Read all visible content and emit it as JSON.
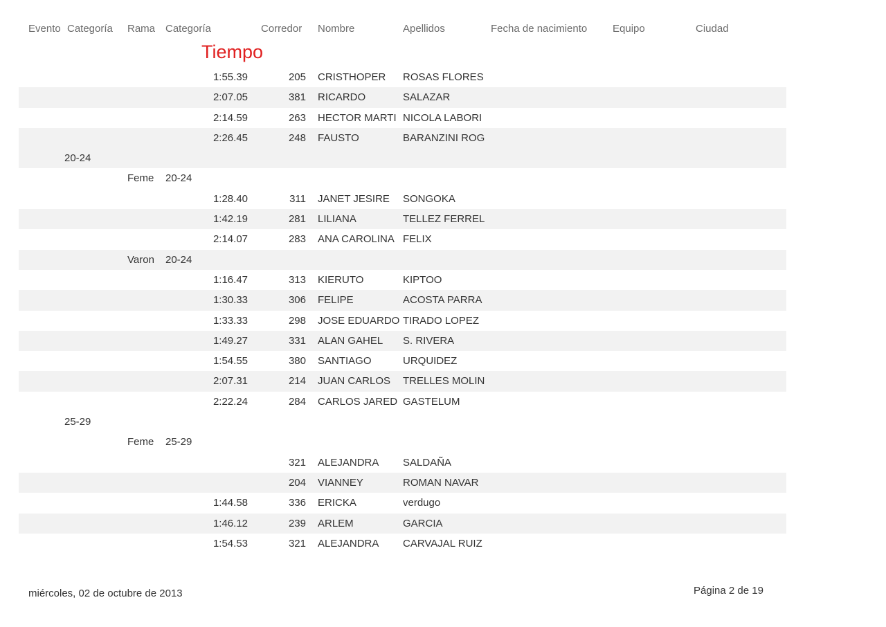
{
  "header": {
    "evento": "Evento",
    "categoria1": "Categoría",
    "rama": "Rama",
    "categoria2": "Categoría",
    "corredor": "Corredor",
    "nombre": "Nombre",
    "apellidos": "Apellidos",
    "fecha": "Fecha de nacimiento",
    "equipo": "Equipo",
    "ciudad": "Ciudad",
    "tiempo": "Tiempo"
  },
  "rows": [
    {
      "grupo": "",
      "rama": "",
      "cat": "",
      "tiempo": "1:55.39",
      "corredor": "205",
      "nombre": "CRISTHOPER",
      "apellidos": "ROSAS FLORES",
      "shade": false
    },
    {
      "grupo": "",
      "rama": "",
      "cat": "",
      "tiempo": "2:07.05",
      "corredor": "381",
      "nombre": "RICARDO",
      "apellidos": "SALAZAR",
      "shade": true
    },
    {
      "grupo": "",
      "rama": "",
      "cat": "",
      "tiempo": "2:14.59",
      "corredor": "263",
      "nombre": "HECTOR MARTI",
      "apellidos": "NICOLA LABORI",
      "shade": false
    },
    {
      "grupo": "",
      "rama": "",
      "cat": "",
      "tiempo": "2:26.45",
      "corredor": "248",
      "nombre": "FAUSTO",
      "apellidos": "BARANZINI ROG",
      "shade": true
    },
    {
      "grupo": "20-24",
      "rama": "",
      "cat": "",
      "tiempo": "",
      "corredor": "",
      "nombre": "",
      "apellidos": "",
      "shade": true
    },
    {
      "grupo": "",
      "rama": "Feme",
      "cat": "20-24",
      "tiempo": "",
      "corredor": "",
      "nombre": "",
      "apellidos": "",
      "shade": false
    },
    {
      "grupo": "",
      "rama": "",
      "cat": "",
      "tiempo": "1:28.40",
      "corredor": "311",
      "nombre": "JANET JESIRE",
      "apellidos": "SONGOKA",
      "shade": false
    },
    {
      "grupo": "",
      "rama": "",
      "cat": "",
      "tiempo": "1:42.19",
      "corredor": "281",
      "nombre": "LILIANA",
      "apellidos": "TELLEZ FERREL",
      "shade": true
    },
    {
      "grupo": "",
      "rama": "",
      "cat": "",
      "tiempo": "2:14.07",
      "corredor": "283",
      "nombre": "ANA CAROLINA",
      "apellidos": "FELIX",
      "shade": false
    },
    {
      "grupo": "",
      "rama": "Varon",
      "cat": "20-24",
      "tiempo": "",
      "corredor": "",
      "nombre": "",
      "apellidos": "",
      "shade": true
    },
    {
      "grupo": "",
      "rama": "",
      "cat": "",
      "tiempo": "1:16.47",
      "corredor": "313",
      "nombre": "KIERUTO",
      "apellidos": "KIPTOO",
      "shade": false
    },
    {
      "grupo": "",
      "rama": "",
      "cat": "",
      "tiempo": "1:30.33",
      "corredor": "306",
      "nombre": "FELIPE",
      "apellidos": "ACOSTA PARRA",
      "shade": true
    },
    {
      "grupo": "",
      "rama": "",
      "cat": "",
      "tiempo": "1:33.33",
      "corredor": "298",
      "nombre": "JOSE EDUARDO",
      "apellidos": "TIRADO LOPEZ",
      "shade": false
    },
    {
      "grupo": "",
      "rama": "",
      "cat": "",
      "tiempo": "1:49.27",
      "corredor": "331",
      "nombre": "ALAN GAHEL",
      "apellidos": "S. RIVERA",
      "shade": true
    },
    {
      "grupo": "",
      "rama": "",
      "cat": "",
      "tiempo": "1:54.55",
      "corredor": "380",
      "nombre": "SANTIAGO",
      "apellidos": "URQUIDEZ",
      "shade": false
    },
    {
      "grupo": "",
      "rama": "",
      "cat": "",
      "tiempo": "2:07.31",
      "corredor": "214",
      "nombre": "JUAN CARLOS",
      "apellidos": "TRELLES MOLIN",
      "shade": true
    },
    {
      "grupo": "",
      "rama": "",
      "cat": "",
      "tiempo": "2:22.24",
      "corredor": "284",
      "nombre": "CARLOS JARED",
      "apellidos": "GASTELUM",
      "shade": false
    },
    {
      "grupo": "25-29",
      "rama": "",
      "cat": "",
      "tiempo": "",
      "corredor": "",
      "nombre": "",
      "apellidos": "",
      "shade": false
    },
    {
      "grupo": "",
      "rama": "Feme",
      "cat": "25-29",
      "tiempo": "",
      "corredor": "",
      "nombre": "",
      "apellidos": "",
      "shade": false
    },
    {
      "grupo": "",
      "rama": "",
      "cat": "",
      "tiempo": "",
      "corredor": "321",
      "nombre": "ALEJANDRA",
      "apellidos": "SALDAÑA",
      "shade": false
    },
    {
      "grupo": "",
      "rama": "",
      "cat": "",
      "tiempo": "",
      "corredor": "204",
      "nombre": "VIANNEY",
      "apellidos": "ROMAN NAVAR",
      "shade": true
    },
    {
      "grupo": "",
      "rama": "",
      "cat": "",
      "tiempo": "1:44.58",
      "corredor": "336",
      "nombre": "ERICKA",
      "apellidos": "verdugo",
      "shade": false
    },
    {
      "grupo": "",
      "rama": "",
      "cat": "",
      "tiempo": "1:46.12",
      "corredor": "239",
      "nombre": "ARLEM",
      "apellidos": "GARCIA",
      "shade": true
    },
    {
      "grupo": "",
      "rama": "",
      "cat": "",
      "tiempo": "1:54.53",
      "corredor": "321",
      "nombre": "ALEJANDRA",
      "apellidos": "CARVAJAL RUIZ",
      "shade": false
    }
  ],
  "footer": {
    "date": "miércoles, 02 de octubre de 2013",
    "page": "Página 2 de 19"
  }
}
